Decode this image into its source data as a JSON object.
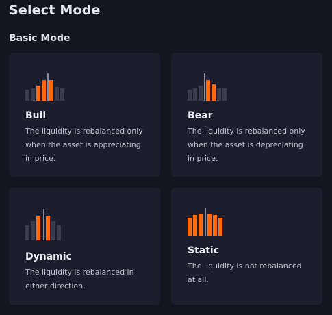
{
  "title": "Select Mode",
  "section": "Basic Mode",
  "modes": [
    {
      "id": "bull",
      "title": "Bull",
      "description": "The liquidity is rebalanced only when the asset is appreciating in price.",
      "icon": "bull-distribution-icon"
    },
    {
      "id": "bear",
      "title": "Bear",
      "description": "The liquidity is rebalanced only when the asset is depreciating in price.",
      "icon": "bear-distribution-icon"
    },
    {
      "id": "dynamic",
      "title": "Dynamic",
      "description": "The liquidity is rebalanced in either direction.",
      "icon": "dynamic-distribution-icon"
    },
    {
      "id": "static",
      "title": "Static",
      "description": "The liquidity is not rebalanced at all.",
      "icon": "static-distribution-icon"
    }
  ],
  "colors": {
    "background": "#13151f",
    "card": "#1c1e2d",
    "accent": "#ff6a0d",
    "inactive_bar": "#3a3d4e",
    "price_line": "#8b8d9a"
  }
}
